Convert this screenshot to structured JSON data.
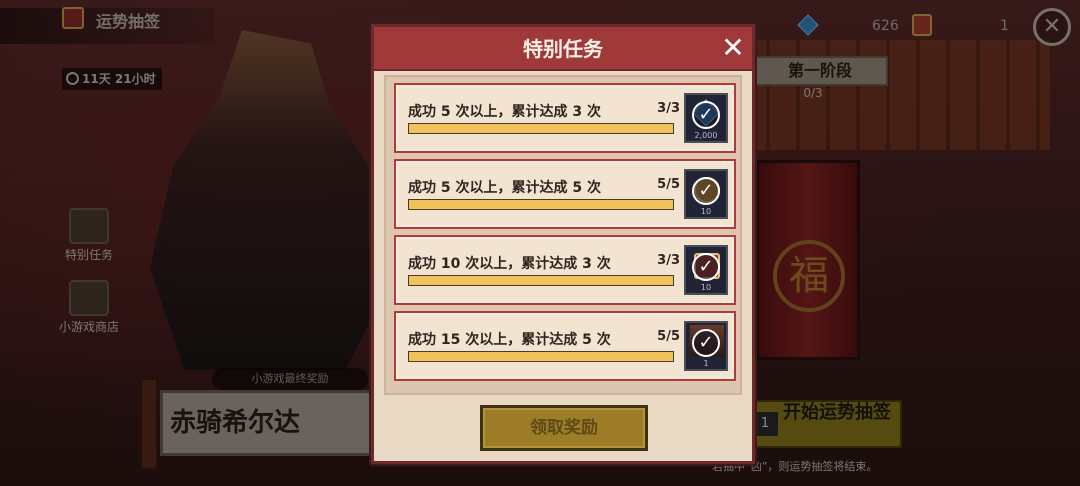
{
  "event": {
    "title": "运势抽签",
    "timer": "11天 21小时"
  },
  "resources": {
    "gems": "626",
    "tickets": "1"
  },
  "side_menu": {
    "special_tasks": "特别任务",
    "mini_shop": "小游戏商店"
  },
  "stage": {
    "label": "第一阶段",
    "progress": "0/3"
  },
  "final_reward": {
    "label": "小游戏最终奖励",
    "name": "赤骑希尔达"
  },
  "start": {
    "cost": "1",
    "label": "开始运势抽签",
    "note": "若抽中“凶”，则运势抽签将结束。"
  },
  "drum": {
    "glyph": "福"
  },
  "modal": {
    "title": "特别任务",
    "close_icon": "close-icon",
    "claim_label": "领取奖励",
    "tasks": [
      {
        "text": "成功 5 次以上，累计达成 3 次",
        "count": "3/3",
        "progress": 1.0,
        "reward_icon": "gem-icon",
        "reward_qty": "2,000",
        "claimed": true
      },
      {
        "text": "成功 5 次以上，累计达成 5 次",
        "count": "5/5",
        "progress": 1.0,
        "reward_icon": "coin-icon",
        "reward_qty": "10",
        "claimed": true
      },
      {
        "text": "成功 10 次以上，累计达成 3 次",
        "count": "3/3",
        "progress": 1.0,
        "reward_icon": "ticket-icon",
        "reward_qty": "10",
        "claimed": true
      },
      {
        "text": "成功 15 次以上，累计达成 5 次",
        "count": "5/5",
        "progress": 1.0,
        "reward_icon": "character-icon",
        "reward_qty": "1",
        "claimed": true
      }
    ]
  },
  "colors": {
    "accent": "#a03a3a",
    "bar_fill": "#f0c25a",
    "claim_button": "#9c7c26"
  }
}
